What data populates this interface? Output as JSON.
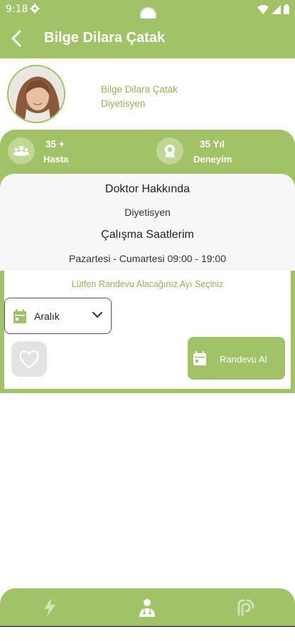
{
  "status_bar": {
    "time": "9:18"
  },
  "header": {
    "title": "Bilge Dilara Çatak"
  },
  "profile": {
    "name": "Bilge Dilara Çatak",
    "role": "Diyetisyen"
  },
  "stats": {
    "patients": {
      "value": "35 +",
      "label": "Hasta",
      "icon": "people-icon"
    },
    "experience": {
      "value": "35 Yıl",
      "label": "Deneyim",
      "icon": "award-icon"
    }
  },
  "about": {
    "heading": "Doktor Hakkında",
    "specialty": "Diyetisyen",
    "hours_heading": "Çalışma Saatlerim",
    "hours": "Pazartesi - Cumartesi 09:00 - 19:00"
  },
  "booking": {
    "prompt": "Lütfen Randevu Alacağınız Ayı Seçiniz",
    "selected_month": "Aralık",
    "appointment_label": "Randevu Al"
  },
  "bottom_nav": {
    "items": [
      {
        "icon": "lightning-icon",
        "active": false
      },
      {
        "icon": "doctor-icon",
        "active": true
      },
      {
        "icon": "broadcast-icon",
        "active": false
      }
    ]
  },
  "colors": {
    "brand": "#a2c268",
    "brand_text": "#93b155",
    "panel": "#f7f7f7"
  }
}
